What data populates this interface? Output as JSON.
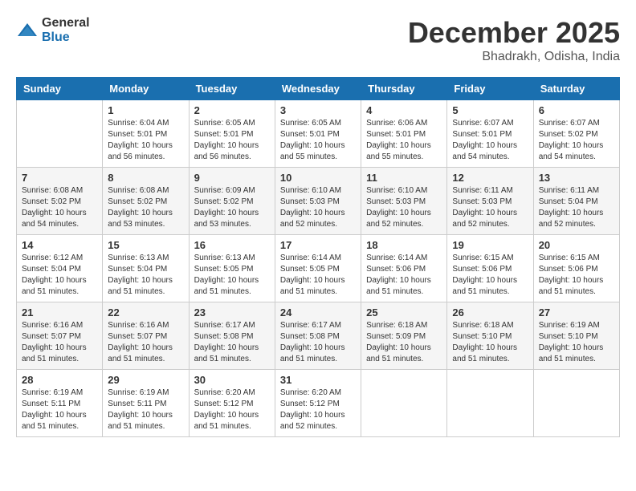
{
  "logo": {
    "text_general": "General",
    "text_blue": "Blue"
  },
  "header": {
    "month": "December 2025",
    "location": "Bhadrakh, Odisha, India"
  },
  "days_of_week": [
    "Sunday",
    "Monday",
    "Tuesday",
    "Wednesday",
    "Thursday",
    "Friday",
    "Saturday"
  ],
  "weeks": [
    [
      {
        "day": "",
        "sunrise": "",
        "sunset": "",
        "daylight": ""
      },
      {
        "day": "1",
        "sunrise": "6:04 AM",
        "sunset": "5:01 PM",
        "daylight": "10 hours and 56 minutes."
      },
      {
        "day": "2",
        "sunrise": "6:05 AM",
        "sunset": "5:01 PM",
        "daylight": "10 hours and 56 minutes."
      },
      {
        "day": "3",
        "sunrise": "6:05 AM",
        "sunset": "5:01 PM",
        "daylight": "10 hours and 55 minutes."
      },
      {
        "day": "4",
        "sunrise": "6:06 AM",
        "sunset": "5:01 PM",
        "daylight": "10 hours and 55 minutes."
      },
      {
        "day": "5",
        "sunrise": "6:07 AM",
        "sunset": "5:01 PM",
        "daylight": "10 hours and 54 minutes."
      },
      {
        "day": "6",
        "sunrise": "6:07 AM",
        "sunset": "5:02 PM",
        "daylight": "10 hours and 54 minutes."
      }
    ],
    [
      {
        "day": "7",
        "sunrise": "6:08 AM",
        "sunset": "5:02 PM",
        "daylight": "10 hours and 54 minutes."
      },
      {
        "day": "8",
        "sunrise": "6:08 AM",
        "sunset": "5:02 PM",
        "daylight": "10 hours and 53 minutes."
      },
      {
        "day": "9",
        "sunrise": "6:09 AM",
        "sunset": "5:02 PM",
        "daylight": "10 hours and 53 minutes."
      },
      {
        "day": "10",
        "sunrise": "6:10 AM",
        "sunset": "5:03 PM",
        "daylight": "10 hours and 52 minutes."
      },
      {
        "day": "11",
        "sunrise": "6:10 AM",
        "sunset": "5:03 PM",
        "daylight": "10 hours and 52 minutes."
      },
      {
        "day": "12",
        "sunrise": "6:11 AM",
        "sunset": "5:03 PM",
        "daylight": "10 hours and 52 minutes."
      },
      {
        "day": "13",
        "sunrise": "6:11 AM",
        "sunset": "5:04 PM",
        "daylight": "10 hours and 52 minutes."
      }
    ],
    [
      {
        "day": "14",
        "sunrise": "6:12 AM",
        "sunset": "5:04 PM",
        "daylight": "10 hours and 51 minutes."
      },
      {
        "day": "15",
        "sunrise": "6:13 AM",
        "sunset": "5:04 PM",
        "daylight": "10 hours and 51 minutes."
      },
      {
        "day": "16",
        "sunrise": "6:13 AM",
        "sunset": "5:05 PM",
        "daylight": "10 hours and 51 minutes."
      },
      {
        "day": "17",
        "sunrise": "6:14 AM",
        "sunset": "5:05 PM",
        "daylight": "10 hours and 51 minutes."
      },
      {
        "day": "18",
        "sunrise": "6:14 AM",
        "sunset": "5:06 PM",
        "daylight": "10 hours and 51 minutes."
      },
      {
        "day": "19",
        "sunrise": "6:15 AM",
        "sunset": "5:06 PM",
        "daylight": "10 hours and 51 minutes."
      },
      {
        "day": "20",
        "sunrise": "6:15 AM",
        "sunset": "5:06 PM",
        "daylight": "10 hours and 51 minutes."
      }
    ],
    [
      {
        "day": "21",
        "sunrise": "6:16 AM",
        "sunset": "5:07 PM",
        "daylight": "10 hours and 51 minutes."
      },
      {
        "day": "22",
        "sunrise": "6:16 AM",
        "sunset": "5:07 PM",
        "daylight": "10 hours and 51 minutes."
      },
      {
        "day": "23",
        "sunrise": "6:17 AM",
        "sunset": "5:08 PM",
        "daylight": "10 hours and 51 minutes."
      },
      {
        "day": "24",
        "sunrise": "6:17 AM",
        "sunset": "5:08 PM",
        "daylight": "10 hours and 51 minutes."
      },
      {
        "day": "25",
        "sunrise": "6:18 AM",
        "sunset": "5:09 PM",
        "daylight": "10 hours and 51 minutes."
      },
      {
        "day": "26",
        "sunrise": "6:18 AM",
        "sunset": "5:10 PM",
        "daylight": "10 hours and 51 minutes."
      },
      {
        "day": "27",
        "sunrise": "6:19 AM",
        "sunset": "5:10 PM",
        "daylight": "10 hours and 51 minutes."
      }
    ],
    [
      {
        "day": "28",
        "sunrise": "6:19 AM",
        "sunset": "5:11 PM",
        "daylight": "10 hours and 51 minutes."
      },
      {
        "day": "29",
        "sunrise": "6:19 AM",
        "sunset": "5:11 PM",
        "daylight": "10 hours and 51 minutes."
      },
      {
        "day": "30",
        "sunrise": "6:20 AM",
        "sunset": "5:12 PM",
        "daylight": "10 hours and 51 minutes."
      },
      {
        "day": "31",
        "sunrise": "6:20 AM",
        "sunset": "5:12 PM",
        "daylight": "10 hours and 52 minutes."
      },
      {
        "day": "",
        "sunrise": "",
        "sunset": "",
        "daylight": ""
      },
      {
        "day": "",
        "sunrise": "",
        "sunset": "",
        "daylight": ""
      },
      {
        "day": "",
        "sunrise": "",
        "sunset": "",
        "daylight": ""
      }
    ]
  ]
}
